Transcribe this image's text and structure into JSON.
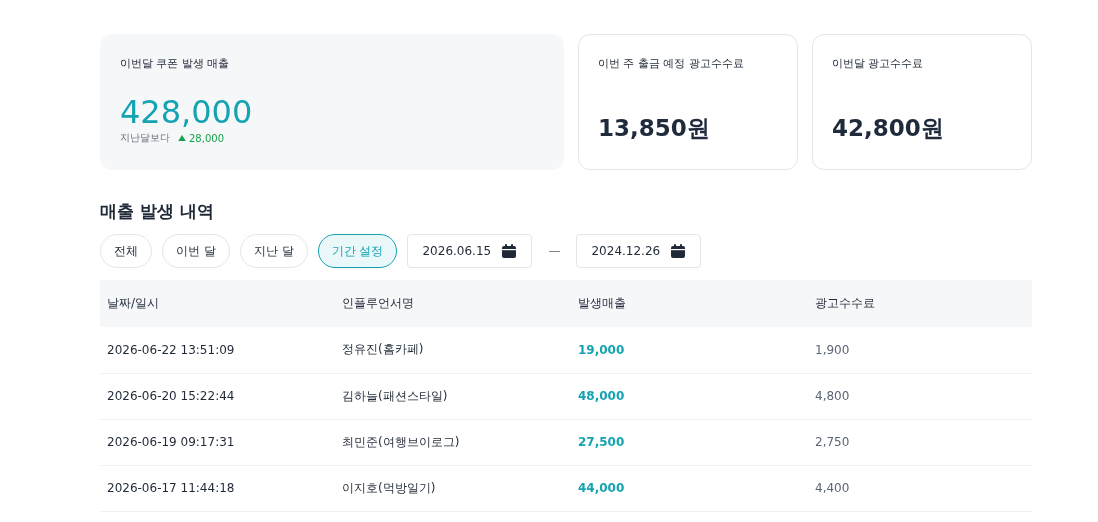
{
  "summary_cards": [
    {
      "kind": "highlight",
      "title": "이번달 쿠폰 발생 매출",
      "value": "428,000",
      "comparison_label": "지난달보다",
      "change": {
        "increase": true,
        "amount": "28,000"
      }
    },
    {
      "kind": "plain",
      "title": "이번 주 출금 예정 광고수수료",
      "value": "13,850원"
    },
    {
      "kind": "plain",
      "title": "이번달 광고수수료",
      "value": "42,800원"
    }
  ],
  "section_title": "매출 발생 내역",
  "filters": [
    {
      "label": "전체",
      "selected": false
    },
    {
      "label": "이번 달",
      "selected": false
    },
    {
      "label": "지난 달",
      "selected": false
    },
    {
      "label": "기간 설정",
      "selected": true
    }
  ],
  "date_range": {
    "start": "2026.06.15",
    "separator": "—",
    "end": "2024.12.26"
  },
  "table": {
    "columns": [
      "날짜/일시",
      "인플루언서명",
      "발생매출",
      "광고수수료"
    ],
    "rows": [
      [
        "2026-06-22 13:51:09",
        "정유진(홈카페)",
        "19,000",
        "1,900"
      ],
      [
        "2026-06-20 15:22:44",
        "김하늘(패션스타일)",
        "48,000",
        "4,800"
      ],
      [
        "2026-06-19 09:17:31",
        "최민준(여행브이로그)",
        "27,500",
        "2,750"
      ],
      [
        "2026-06-17 11:44:18",
        "이지호(먹방일기)",
        "44,000",
        "4,400"
      ]
    ]
  }
}
